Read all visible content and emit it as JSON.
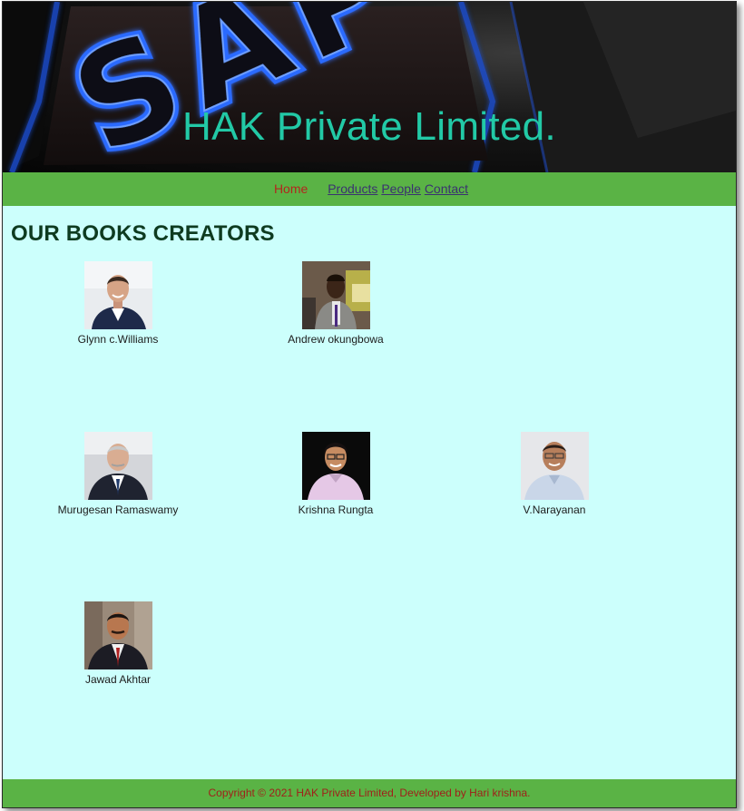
{
  "header": {
    "title": "HAK Private Limited.",
    "banner_text": "SAP"
  },
  "nav": {
    "items": [
      {
        "label": "Home"
      },
      {
        "label": "Products"
      },
      {
        "label": "People"
      },
      {
        "label": "Contact"
      }
    ]
  },
  "main": {
    "heading": "OUR BOOKS CREATORS",
    "people": [
      {
        "name": "Glynn c.Williams"
      },
      {
        "name": "Andrew okungbowa"
      },
      {
        "name": "Murugesan Ramaswamy"
      },
      {
        "name": "Krishna Rungta"
      },
      {
        "name": "V.Narayanan"
      },
      {
        "name": "Jawad Akhtar"
      }
    ]
  },
  "footer": {
    "text": "Copyright © 2021 HAK Private Limited, Developed by Hari krishna."
  },
  "colors": {
    "nav_background": "#5ab345",
    "page_background": "#ccfffc",
    "title_color": "#22c9a6",
    "home_link": "#b3261e",
    "footer_text": "#a0201a"
  }
}
